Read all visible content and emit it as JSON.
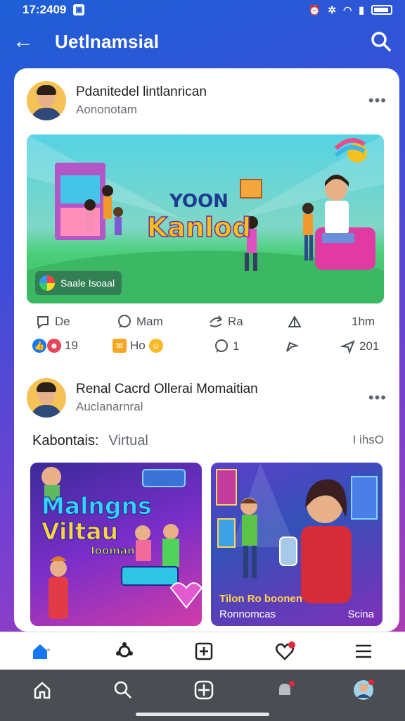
{
  "status": {
    "time": "17:2409"
  },
  "appbar": {
    "title": "Uetlnamsial"
  },
  "post1": {
    "name": "Pdanitedel lintlanrican",
    "subtitle": "Aononotam",
    "more": "•••",
    "hero": {
      "line1": "YOON",
      "line2": "Kanlod",
      "badge": "Saale Isoaal"
    },
    "actions": [
      "De",
      "Mam",
      "Ra",
      "",
      "1hm"
    ],
    "reactions": [
      {
        "text": "19"
      },
      {
        "text": "Ho"
      },
      {
        "text": "1"
      },
      {
        "text": ""
      },
      {
        "text": "201"
      }
    ]
  },
  "post2": {
    "name": "Renal Cacrd Ollerai Momaitian",
    "subtitle": "Auclanarnral",
    "more": "•••",
    "section_label": "Kabontais:",
    "section_value": "Virtual",
    "section_link": "I ihsO",
    "tile1": {
      "line1": "Malngns",
      "line2": "Viltau",
      "line3": "Iooman"
    },
    "tile2": {
      "line1": "Tilon Ro boonen",
      "line2": "Ronnomcas",
      "line3": "Scina"
    }
  },
  "colors": {
    "brand": "#1d5fd6",
    "accent": "#e02a3a",
    "text": "#1c1e21"
  }
}
